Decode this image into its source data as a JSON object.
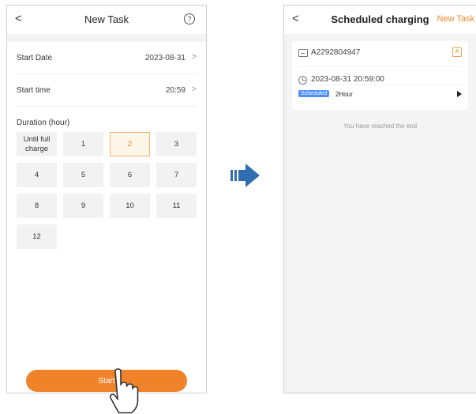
{
  "left_screen": {
    "title": "New Task",
    "back_glyph": "<",
    "help_glyph": "?",
    "start_date": {
      "label": "Start Date",
      "value": "2023-08-31",
      "chevron": ">"
    },
    "start_time": {
      "label": "Start time",
      "value": "20:59",
      "chevron": ">"
    },
    "duration_label": "Duration (hour)",
    "durations": [
      "Until full charge",
      "1",
      "2",
      "3",
      "4",
      "5",
      "6",
      "7",
      "8",
      "9",
      "10",
      "11",
      "12"
    ],
    "selected_duration": "2",
    "start_button": "Start"
  },
  "right_screen": {
    "back_glyph": "<",
    "title": "Scheduled charging",
    "new_task": "New Task",
    "task": {
      "charger_id": "A2292804947",
      "badge": "A",
      "datetime": "2023-08-31 20:59:00",
      "status": "Scheduled",
      "duration": "2Hour"
    },
    "end_text": "You have reached the end"
  },
  "colors": {
    "accent": "#f08a2c",
    "status_blue": "#4e8ff5",
    "arrow_blue": "#2f6fb0"
  },
  "icons": [
    "chevron-left-icon",
    "help-icon",
    "chevron-right-icon",
    "hand-pointer-icon",
    "flow-arrow-icon",
    "card-icon",
    "clock-icon",
    "play-icon"
  ]
}
